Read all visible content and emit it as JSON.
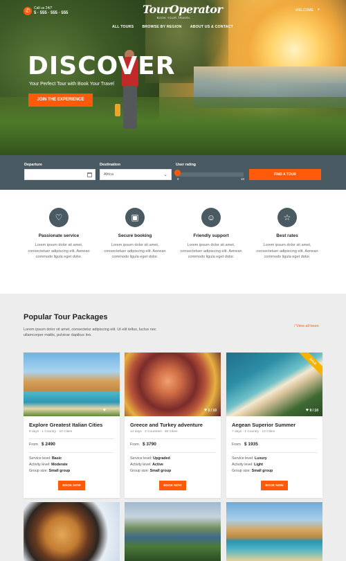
{
  "header": {
    "call_label": "Call us 24/7",
    "phone": "5 · 555 · 555 · 555",
    "logo_name": "TourOperator",
    "logo_tag": "BOOK YOUR TRAVEL",
    "welcome": "WELCOME",
    "nav": [
      "ALL TOURS",
      "BROWSE BY REGION",
      "ABOUT US & CONTACT"
    ]
  },
  "hero": {
    "title": "DISCOVER",
    "subtitle": "Your Perfect Tour with Book Your Travel",
    "cta": "JOIN THE EXPERIENCE"
  },
  "search": {
    "departure_label": "Departure",
    "departure_value": "",
    "destination_label": "Destination",
    "destination_value": "Africa",
    "rating_label": "User rating",
    "rating_min": "0",
    "rating_max": "10",
    "find_button": "FIND A TOUR"
  },
  "features": [
    {
      "icon": "heart-icon",
      "title": "Passionate service",
      "text": "Lorem ipsum dolor sit amet, consectetuer adipiscing elit. Aenean commodo ligula eget dolor."
    },
    {
      "icon": "calendar-icon",
      "title": "Secure booking",
      "text": "Lorem ipsum dolor sit amet, consectetuer adipiscing elit. Aenean commodo ligula eget dolor."
    },
    {
      "icon": "smile-icon",
      "title": "Friendly support",
      "text": "Lorem ipsum dolor sit amet, consectetuer adipiscing elit. Aenean commodo ligula eget dolor."
    },
    {
      "icon": "star-icon",
      "title": "Best rates",
      "text": "Lorem ipsum dolor sit amet, consectetuer adipiscing elit. Aenean commodo ligula eget dolor."
    }
  ],
  "popular": {
    "title": "Popular Tour Packages",
    "subtitle": "Lorem ipsum dolor sit amet, consectetur adipiscing elit. Ut elit tellus, luctus nec ullamcorper mattis, pulvinar dapibus leo.",
    "view_all": "/ View all tours",
    "cards": [
      {
        "title": "Explore Greatest Italian Cities",
        "meta": "9 days · 1 Country · 10 Cities",
        "from": "From",
        "price": "$ 2490",
        "photos": "",
        "service": "Basic",
        "activity": "Moderate",
        "group": "Small group",
        "button": "BOOK NOW",
        "ribbon": ""
      },
      {
        "title": "Greece and Turkey adventure",
        "meta": "14 days · 2 Countries · 35 Cities",
        "from": "From",
        "price": "$ 3790",
        "photos": "3 / 10",
        "service": "Upgraded",
        "activity": "Active",
        "group": "Small group",
        "button": "BOOK NOW",
        "ribbon": ""
      },
      {
        "title": "Aegean Superior Summer",
        "meta": "7 days · 1 Country · 13 Cities",
        "from": "From",
        "price": "$ 1935",
        "photos": "9 / 10",
        "service": "Luxury",
        "activity": "Light",
        "group": "Small group",
        "button": "BOOK NOW",
        "ribbon": "SALE"
      }
    ],
    "spec_labels": {
      "service": "Service level:",
      "activity": "Activity level:",
      "group": "Group size:"
    }
  },
  "colors": {
    "accent": "#ff5a0a",
    "bar": "#4a5a62",
    "section_bg": "#ededed"
  }
}
